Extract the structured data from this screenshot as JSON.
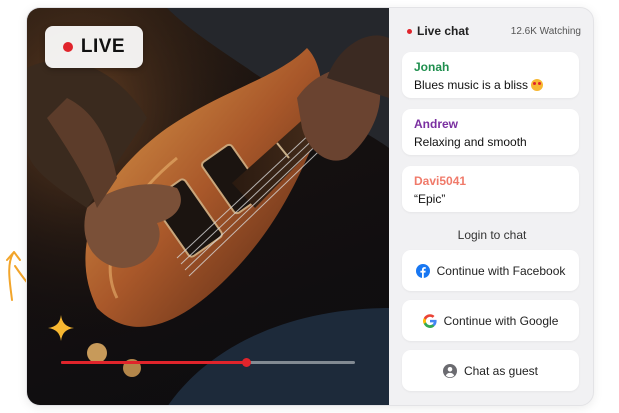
{
  "video": {
    "live_label": "LIVE",
    "progress": 0.63,
    "colors": {
      "live": "#e0242b"
    }
  },
  "chat": {
    "title": "Live chat",
    "watching": "12.6K Watching",
    "messages": [
      {
        "user": "Jonah",
        "text": "Blues music is a bliss",
        "color": "#1f8f4e",
        "emoji": "heart-eyes-emoji"
      },
      {
        "user": "Andrew",
        "text": "Relaxing and smooth",
        "color": "#7a2fa0"
      },
      {
        "user": "Davi5041",
        "text": "“Epic”",
        "color": "#f07a6a"
      }
    ],
    "login_label": "Login to chat",
    "buttons": [
      {
        "label": "Continue with Facebook",
        "icon": "facebook-icon"
      },
      {
        "label": "Continue with Google",
        "icon": "google-icon"
      },
      {
        "label": "Chat as guest",
        "icon": "user-icon"
      }
    ]
  }
}
